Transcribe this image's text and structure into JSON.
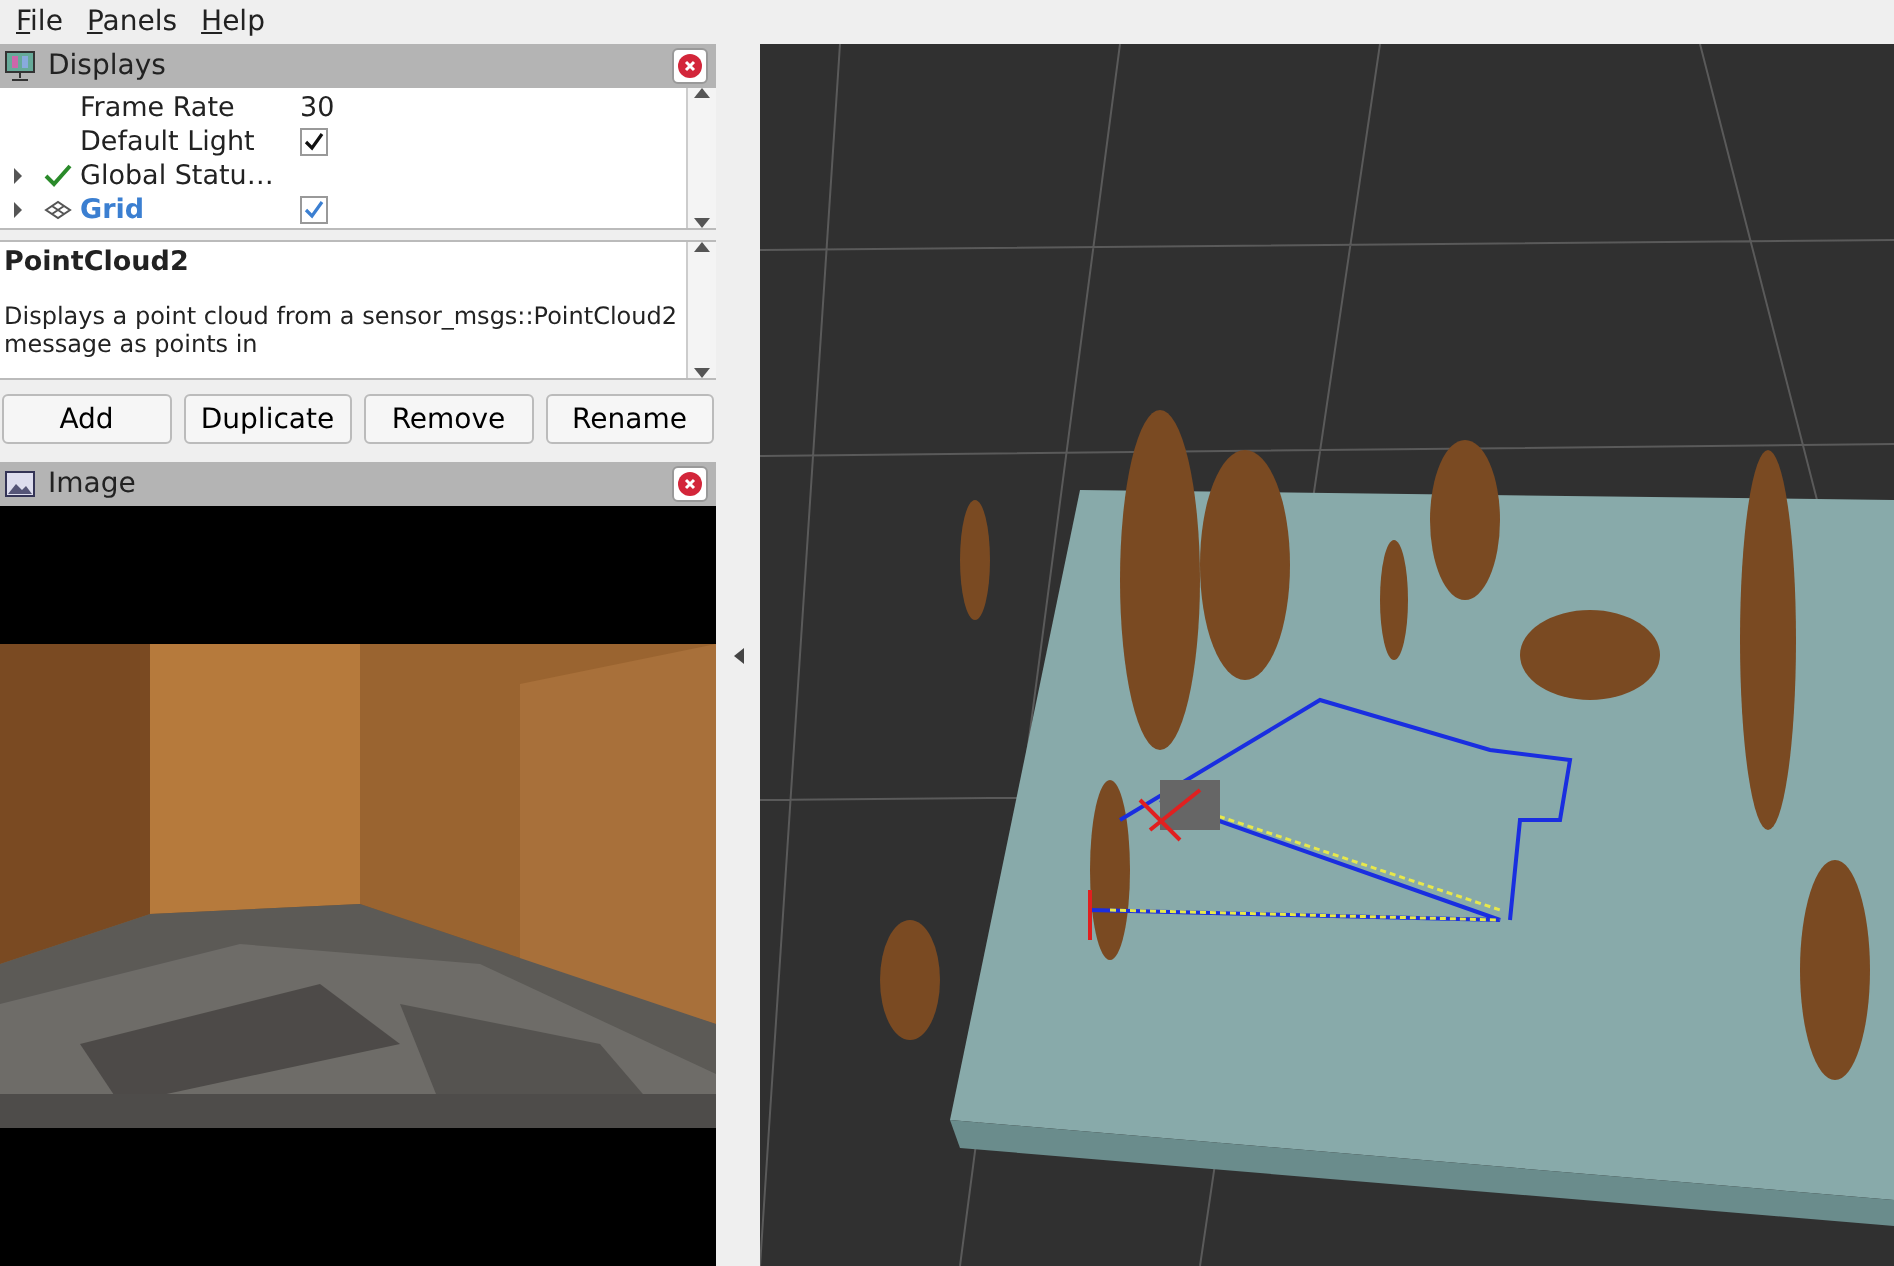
{
  "menu": [
    {
      "label": "File"
    },
    {
      "label": "Panels"
    },
    {
      "label": "Help"
    }
  ],
  "displays_panel": {
    "title": "Displays",
    "rows": [
      {
        "kind": "value",
        "label": "Frame Rate",
        "value": "30"
      },
      {
        "kind": "checkbox",
        "label": "Default Light",
        "checked": true
      },
      {
        "kind": "status",
        "label": "Global Statu…",
        "expanded": false
      },
      {
        "kind": "display",
        "label": "Grid",
        "checked": true,
        "expanded": false
      }
    ],
    "description": {
      "title": "PointCloud2",
      "text": "Displays a point cloud from a sensor_msgs::PointCloud2 message as points in"
    },
    "buttons": [
      "Add",
      "Duplicate",
      "Remove",
      "Rename"
    ]
  },
  "image_panel": {
    "title": "Image"
  }
}
